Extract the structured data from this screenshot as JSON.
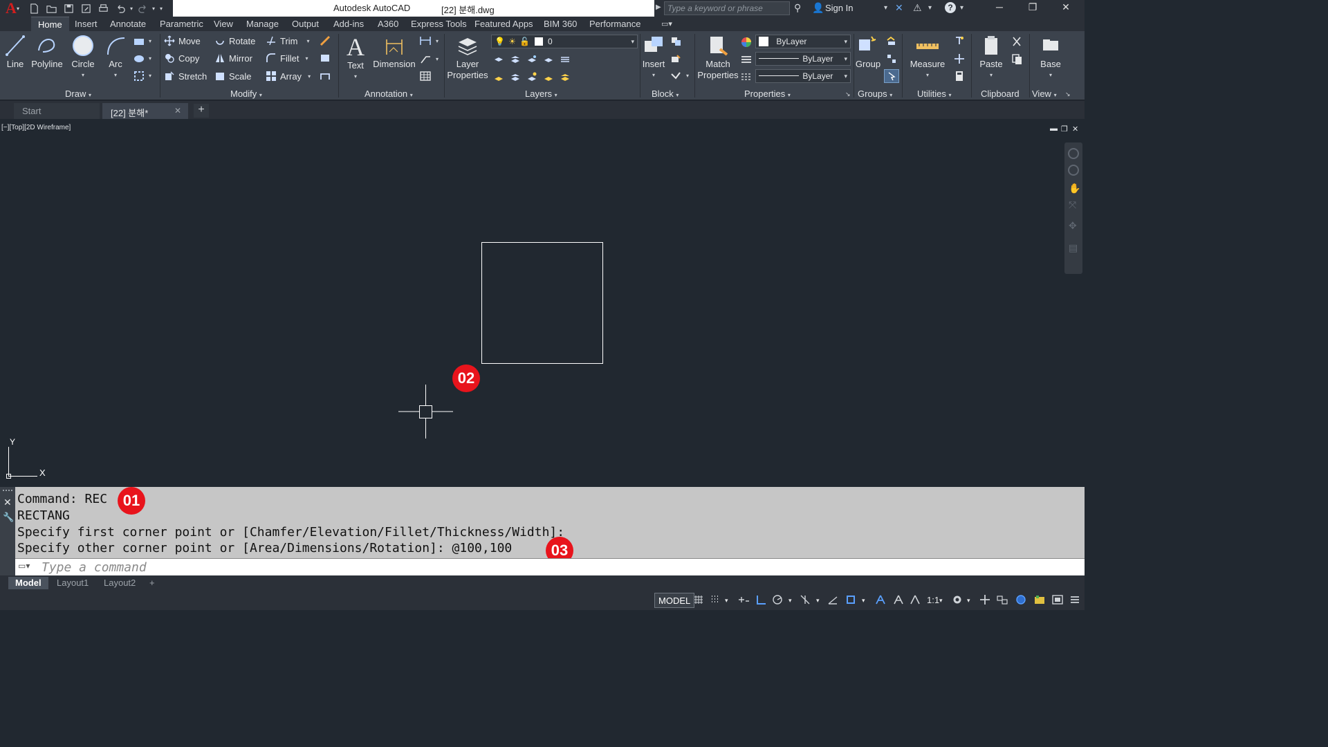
{
  "app": {
    "name": "Autodesk AutoCAD",
    "file": "[22] 분해.dwg",
    "search_placeholder": "Type a keyword or phrase",
    "sign_in": "Sign In"
  },
  "ribbon_tabs": [
    "Home",
    "Insert",
    "Annotate",
    "Parametric",
    "View",
    "Manage",
    "Output",
    "Add-ins",
    "A360",
    "Express Tools",
    "Featured Apps",
    "BIM 360",
    "Performance"
  ],
  "draw": {
    "line": "Line",
    "polyline": "Polyline",
    "circle": "Circle",
    "arc": "Arc",
    "title": "Draw"
  },
  "modify": {
    "move": "Move",
    "rotate": "Rotate",
    "trim": "Trim",
    "copy": "Copy",
    "mirror": "Mirror",
    "fillet": "Fillet",
    "stretch": "Stretch",
    "scale": "Scale",
    "array": "Array",
    "title": "Modify"
  },
  "annotation": {
    "text": "Text",
    "dimension": "Dimension",
    "title": "Annotation"
  },
  "layers": {
    "layer_properties_1": "Layer",
    "layer_properties_2": "Properties",
    "current_layer": "0",
    "title": "Layers"
  },
  "block": {
    "insert": "Insert",
    "title": "Block"
  },
  "properties": {
    "match_1": "Match",
    "match_2": "Properties",
    "color": "ByLayer",
    "linetype": "ByLayer",
    "lineweight": "ByLayer",
    "title": "Properties"
  },
  "groups": {
    "group": "Group",
    "title": "Groups"
  },
  "utilities": {
    "measure": "Measure",
    "title": "Utilities"
  },
  "clipboard": {
    "paste": "Paste",
    "title": "Clipboard"
  },
  "view": {
    "base": "Base",
    "title": "View"
  },
  "file_tabs": {
    "start": "Start",
    "current": "[22] 분해*"
  },
  "viewport": {
    "label": "[−][Top][2D Wireframe]",
    "axis_x": "X",
    "axis_y": "Y"
  },
  "badges": {
    "b1": "01",
    "b2": "02",
    "b3": "03"
  },
  "command": {
    "line1": "Command: REC",
    "line2": "RECTANG",
    "line3": "Specify first corner point or [Chamfer/Elevation/Fillet/Thickness/Width]:",
    "line4": "Specify other corner point or [Area/Dimensions/Rotation]: @100,100",
    "placeholder": "Type a command"
  },
  "layout_tabs": [
    "Model",
    "Layout1",
    "Layout2"
  ],
  "status": {
    "model": "MODEL",
    "scale": "1:1"
  }
}
